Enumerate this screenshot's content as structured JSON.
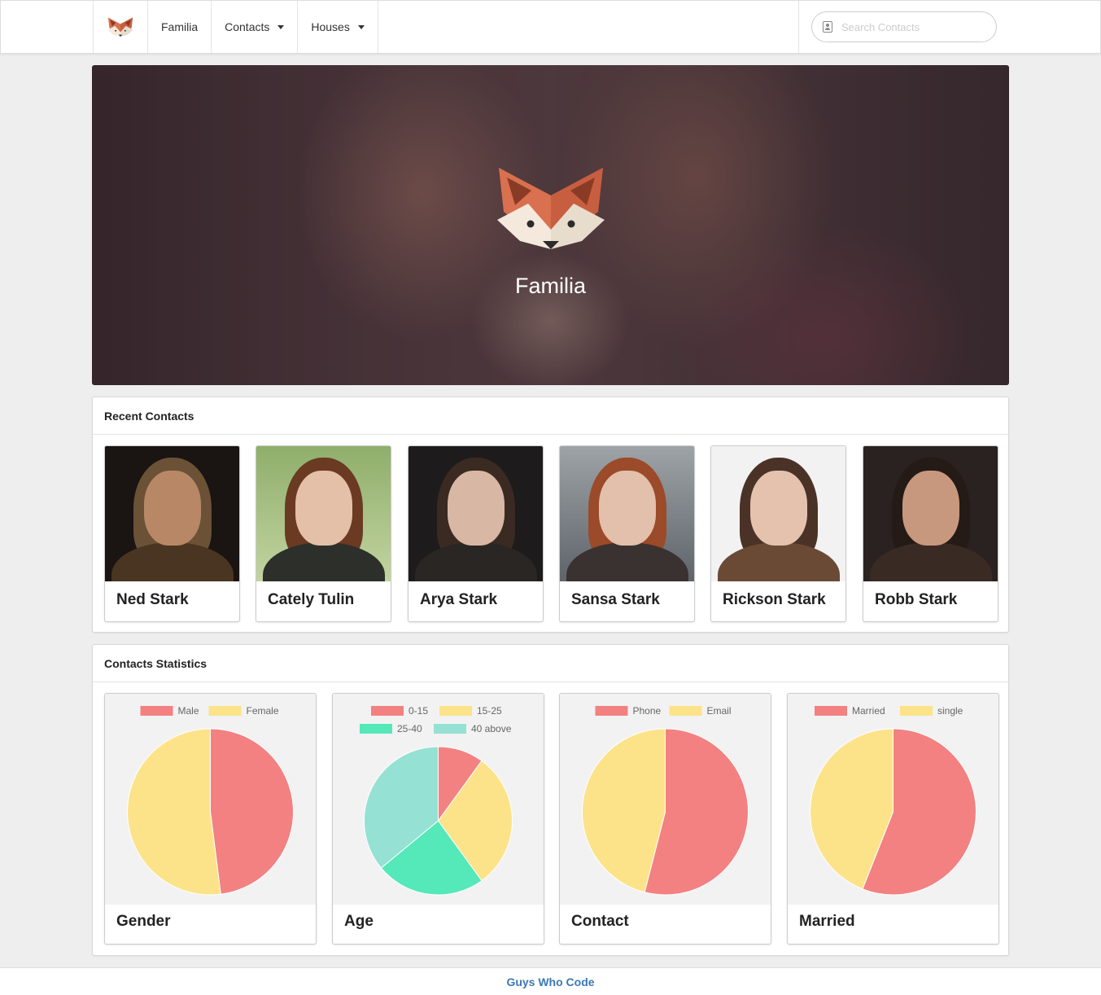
{
  "nav": {
    "brand": "fox-logo",
    "items": [
      {
        "label": "Familia",
        "dropdown": false
      },
      {
        "label": "Contacts",
        "dropdown": true
      },
      {
        "label": "Houses",
        "dropdown": true
      }
    ],
    "search": {
      "placeholder": "Search Contacts",
      "value": ""
    }
  },
  "hero": {
    "title": "Familia"
  },
  "recent": {
    "heading": "Recent Contacts",
    "contacts": [
      {
        "name": "Ned Stark"
      },
      {
        "name": "Cately Tulin"
      },
      {
        "name": "Arya Stark"
      },
      {
        "name": "Sansa Stark"
      },
      {
        "name": "Rickson Stark"
      },
      {
        "name": "Robb Stark"
      }
    ]
  },
  "stats": {
    "heading": "Contacts Statistics"
  },
  "chart_data": [
    {
      "type": "pie",
      "title": "Gender",
      "categories": [
        "Male",
        "Female"
      ],
      "values": [
        48,
        52
      ],
      "colors": [
        "#f38181",
        "#fce38a"
      ]
    },
    {
      "type": "pie",
      "title": "Age",
      "categories": [
        "0-15",
        "15-25",
        "25-40",
        "40 above"
      ],
      "values": [
        10,
        30,
        24,
        36
      ],
      "colors": [
        "#f38181",
        "#fce38a",
        "#55e8b9",
        "#95e1d3"
      ]
    },
    {
      "type": "pie",
      "title": "Contact",
      "categories": [
        "Phone",
        "Email"
      ],
      "values": [
        54,
        46
      ],
      "colors": [
        "#f38181",
        "#fce38a"
      ]
    },
    {
      "type": "pie",
      "title": "Married",
      "categories": [
        "Married",
        "single"
      ],
      "values": [
        56,
        44
      ],
      "colors": [
        "#f38181",
        "#fce38a"
      ]
    }
  ],
  "footer": {
    "link": "Guys Who Code"
  }
}
